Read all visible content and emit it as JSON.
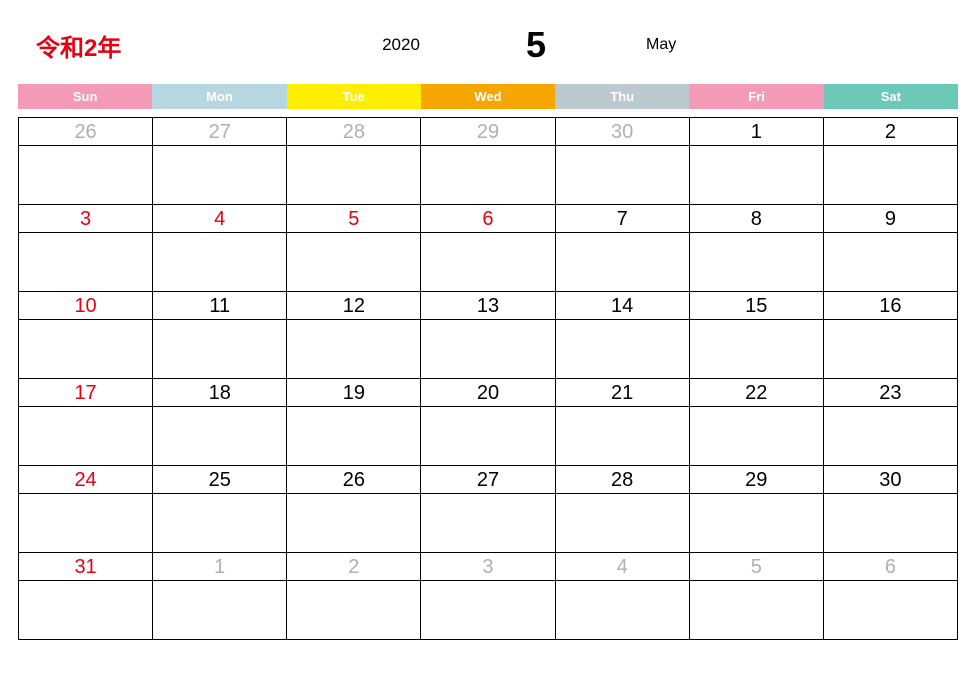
{
  "header": {
    "era": "令和2年",
    "year": "2020",
    "month_num": "5",
    "month_en": "May"
  },
  "dow": [
    "Sun",
    "Mon",
    "Tue",
    "Wed",
    "Thu",
    "Fri",
    "Sat"
  ],
  "weeks": [
    [
      {
        "n": "26",
        "c": "muted"
      },
      {
        "n": "27",
        "c": "muted"
      },
      {
        "n": "28",
        "c": "muted"
      },
      {
        "n": "29",
        "c": "muted"
      },
      {
        "n": "30",
        "c": "muted"
      },
      {
        "n": "1",
        "c": ""
      },
      {
        "n": "2",
        "c": ""
      }
    ],
    [
      {
        "n": "3",
        "c": "holiday"
      },
      {
        "n": "4",
        "c": "holiday"
      },
      {
        "n": "5",
        "c": "holiday"
      },
      {
        "n": "6",
        "c": "holiday"
      },
      {
        "n": "7",
        "c": ""
      },
      {
        "n": "8",
        "c": ""
      },
      {
        "n": "9",
        "c": ""
      }
    ],
    [
      {
        "n": "10",
        "c": "holiday"
      },
      {
        "n": "11",
        "c": ""
      },
      {
        "n": "12",
        "c": ""
      },
      {
        "n": "13",
        "c": ""
      },
      {
        "n": "14",
        "c": ""
      },
      {
        "n": "15",
        "c": ""
      },
      {
        "n": "16",
        "c": ""
      }
    ],
    [
      {
        "n": "17",
        "c": "holiday"
      },
      {
        "n": "18",
        "c": ""
      },
      {
        "n": "19",
        "c": ""
      },
      {
        "n": "20",
        "c": ""
      },
      {
        "n": "21",
        "c": ""
      },
      {
        "n": "22",
        "c": ""
      },
      {
        "n": "23",
        "c": ""
      }
    ],
    [
      {
        "n": "24",
        "c": "holiday"
      },
      {
        "n": "25",
        "c": ""
      },
      {
        "n": "26",
        "c": ""
      },
      {
        "n": "27",
        "c": ""
      },
      {
        "n": "28",
        "c": ""
      },
      {
        "n": "29",
        "c": ""
      },
      {
        "n": "30",
        "c": ""
      }
    ],
    [
      {
        "n": "31",
        "c": "holiday"
      },
      {
        "n": "1",
        "c": "muted"
      },
      {
        "n": "2",
        "c": "muted"
      },
      {
        "n": "3",
        "c": "muted"
      },
      {
        "n": "4",
        "c": "muted"
      },
      {
        "n": "5",
        "c": "muted"
      },
      {
        "n": "6",
        "c": "muted"
      }
    ]
  ]
}
